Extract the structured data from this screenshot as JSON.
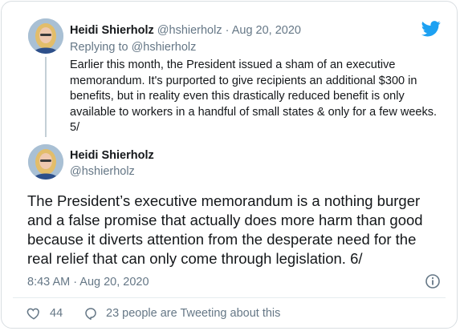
{
  "reply_tweet": {
    "author_name": "Heidi Shierholz",
    "handle": "@hshierholz",
    "separator": "·",
    "date": "Aug 20, 2020",
    "replying_prefix": "Replying to",
    "replying_to": "@hshierholz",
    "text": "Earlier this month, the President issued a sham of an executive memorandum. It's purported to give recipients an additional $300 in benefits, but in reality even this drastically reduced benefit is only available to workers in a handful of small states & only for a few weeks. 5/"
  },
  "main_tweet": {
    "author_name": "Heidi Shierholz",
    "handle": "@hshierholz",
    "text": "The President’s executive memorandum is a nothing burger and a false promise that actually does more harm than good because it diverts attention from the desperate need for the real relief that can only come through legislation. 6/",
    "timestamp": "8:43 AM · Aug 20, 2020"
  },
  "engagement": {
    "likes": "44",
    "tweeting_text": "23 people are Tweeting about this"
  },
  "icons": {
    "logo": "twitter-bird-icon",
    "info": "info-icon",
    "like": "heart-icon",
    "conversation": "speech-bubble-icon"
  },
  "colors": {
    "twitter_blue": "#1da1f2",
    "muted_text": "#657786",
    "primary_text": "#14171a"
  }
}
